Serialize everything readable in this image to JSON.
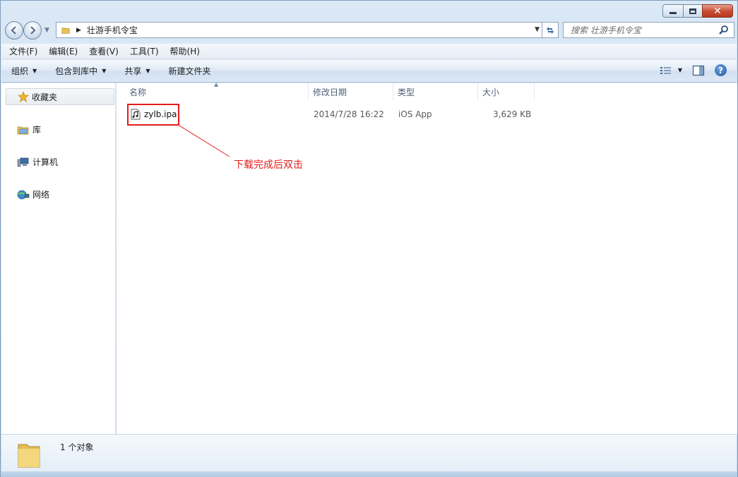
{
  "window": {
    "caption": {
      "close_glyph": "✕"
    }
  },
  "address": {
    "path": "壮游手机令宝",
    "search_placeholder": "搜索 壮游手机令宝"
  },
  "menu": {
    "items": [
      {
        "label": "文件(F)"
      },
      {
        "label": "编辑(E)"
      },
      {
        "label": "查看(V)"
      },
      {
        "label": "工具(T)"
      },
      {
        "label": "帮助(H)"
      }
    ]
  },
  "toolbar": {
    "organize": "组织",
    "include_in_library": "包含到库中",
    "share": "共享",
    "new_folder": "新建文件夹",
    "help_glyph": "?"
  },
  "sidebar": {
    "favorites": "收藏夹",
    "libraries": "库",
    "computer": "计算机",
    "network": "网络"
  },
  "columns": {
    "name": "名称",
    "date_modified": "修改日期",
    "type": "类型",
    "size": "大小"
  },
  "files": [
    {
      "name": "zylb.ipa",
      "date": "2014/7/28 16:22",
      "type": "iOS App",
      "size": "3,629 KB"
    }
  ],
  "annotation": {
    "text": "下载完成后双击",
    "color": "#e41b1b"
  },
  "details": {
    "count": "1 个对象"
  }
}
